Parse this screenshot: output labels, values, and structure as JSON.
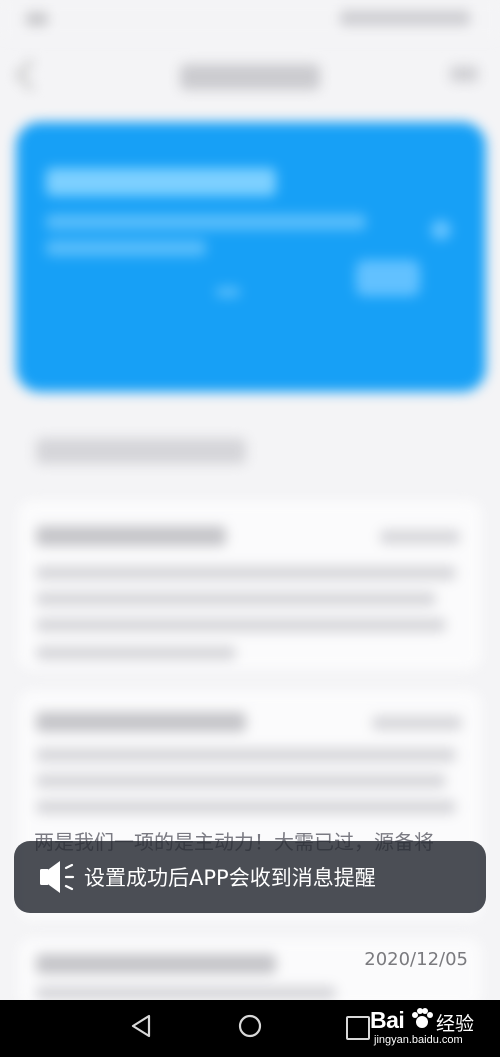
{
  "toast": {
    "message": "设置成功后APP会收到消息提醒",
    "icon": "speaker-icon"
  },
  "background": {
    "partial_text": "两是我们一项的是主动力！大需已过，源备将",
    "card3_date": "2020/12/05"
  },
  "navbar": {
    "back_icon": "triangle-back-icon",
    "home_icon": "circle-home-icon",
    "recent_icon": "square-recent-icon"
  },
  "watermark": {
    "brand": "Bai",
    "brand_suffix": "经验",
    "url": "jingyan.baidu.com"
  },
  "colors": {
    "hero_blue": "#17a0f6",
    "toast_bg": "#2c3038",
    "navbar": "#000000"
  }
}
